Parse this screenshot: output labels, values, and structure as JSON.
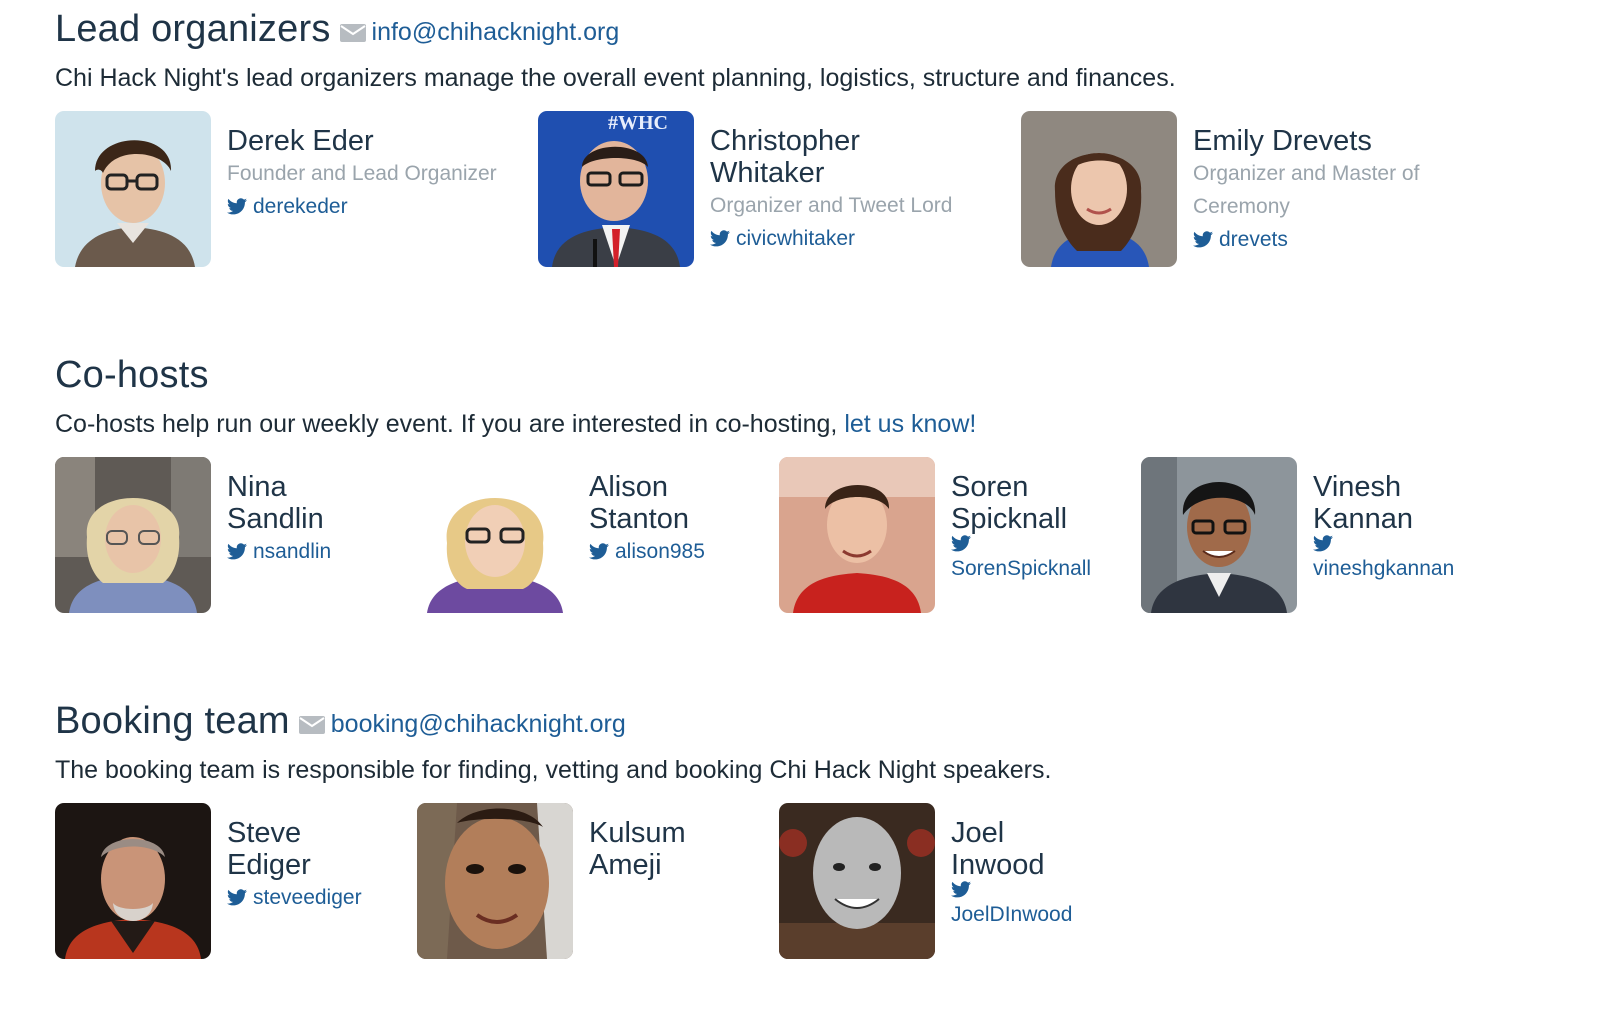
{
  "lead": {
    "title": "Lead organizers",
    "email": "info@chihacknight.org",
    "description": "Chi Hack Night's lead organizers manage the overall event planning, logistics, structure and finances.",
    "people": [
      {
        "name_line1": "Derek Eder",
        "name_line2": "",
        "role_line1": "Founder and Lead Organizer",
        "role_line2": "",
        "twitter": "derekeder"
      },
      {
        "name_line1": "Christopher",
        "name_line2": "Whitaker",
        "role_line1": "Organizer and Tweet Lord",
        "role_line2": "",
        "twitter": "civicwhitaker",
        "photo_banner": "#WHC"
      },
      {
        "name_line1": "Emily Drevets",
        "name_line2": "",
        "role_line1": "Organizer and Master of",
        "role_line2": "Ceremony",
        "twitter": "drevets"
      }
    ]
  },
  "cohosts": {
    "title": "Co-hosts",
    "description": "Co-hosts help run our weekly event. If you are interested in co-hosting, ",
    "link": "let us know!",
    "people": [
      {
        "name_line1": "Nina",
        "name_line2": "Sandlin",
        "twitter": "nsandlin"
      },
      {
        "name_line1": "Alison",
        "name_line2": "Stanton",
        "twitter": "alison985"
      },
      {
        "name_line1": "Soren",
        "name_line2": "Spicknall",
        "twitter": "SorenSpicknall"
      },
      {
        "name_line1": "Vinesh",
        "name_line2": "Kannan",
        "twitter": "vineshgkannan"
      }
    ]
  },
  "booking": {
    "title": "Booking team",
    "email": "booking@chihacknight.org",
    "description": "The booking team is responsible for finding, vetting and booking Chi Hack Night speakers.",
    "people": [
      {
        "name_line1": "Steve",
        "name_line2": "Ediger",
        "twitter": "steveediger"
      },
      {
        "name_line1": "Kulsum",
        "name_line2": "Ameji",
        "twitter": ""
      },
      {
        "name_line1": "Joel",
        "name_line2": "Inwood",
        "twitter": "JoelDInwood"
      }
    ]
  },
  "icons": {
    "email": "envelope-icon",
    "twitter": "twitter-bird-icon"
  },
  "colors": {
    "link": "#1e5d96",
    "heading": "#1f3447",
    "role": "#9aa4ac",
    "mail_icon": "#b7bcc1"
  }
}
